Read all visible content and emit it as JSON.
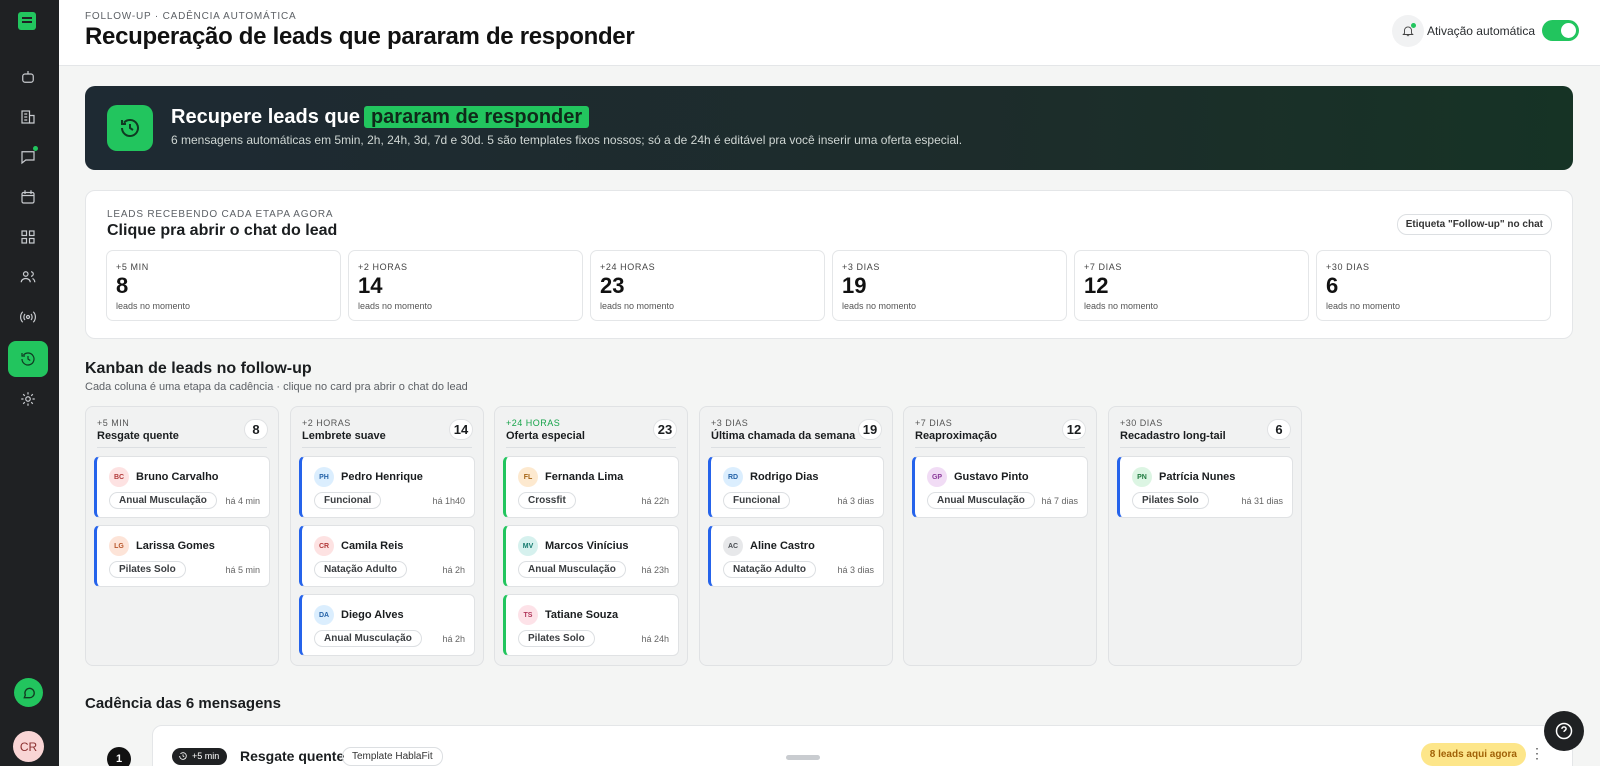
{
  "sidebar": {
    "user_initials": "CR",
    "items": [
      {
        "name": "bot-icon"
      },
      {
        "name": "building-icon"
      },
      {
        "name": "chat-icon"
      },
      {
        "name": "calendar-icon"
      },
      {
        "name": "grid-icon"
      },
      {
        "name": "users-icon"
      },
      {
        "name": "broadcast-icon"
      },
      {
        "name": "history-icon"
      },
      {
        "name": "gear-icon"
      }
    ]
  },
  "header": {
    "eyebrow": "FOLLOW-UP · CADÊNCIA AUTOMÁTICA",
    "title": "Recuperação de leads que pararam de responder",
    "toggle_label": "Ativação automática",
    "toggle_on": true
  },
  "banner": {
    "title_prefix": "Recupere leads que",
    "title_highlight": "pararam de responder",
    "subtitle": "6 mensagens automáticas em 5min, 2h, 24h, 3d, 7d e 30d. 5 são templates fixos nossos; só a de 24h é editável pra você inserir uma oferta especial."
  },
  "stats": {
    "eyebrow": "LEADS RECEBENDO CADA ETAPA AGORA",
    "title": "Clique pra abrir o chat do lead",
    "chip": "Etiqueta \"Follow-up\" no chat",
    "items": [
      {
        "label": "+5 MIN",
        "value": "8",
        "caption": "leads no momento"
      },
      {
        "label": "+2 HORAS",
        "value": "14",
        "caption": "leads no momento"
      },
      {
        "label": "+24 HORAS",
        "value": "23",
        "caption": "leads no momento"
      },
      {
        "label": "+3 DIAS",
        "value": "19",
        "caption": "leads no momento"
      },
      {
        "label": "+7 DIAS",
        "value": "12",
        "caption": "leads no momento"
      },
      {
        "label": "+30 DIAS",
        "value": "6",
        "caption": "leads no momento"
      }
    ]
  },
  "kanban": {
    "title": "Kanban de leads no follow-up",
    "subtitle": "Cada coluna é uma etapa da cadência · clique no card pra abrir o chat do lead",
    "columns": [
      {
        "tag": "+5 MIN",
        "name": "Resgate quente",
        "count": "8",
        "leads": [
          {
            "initials": "BC",
            "name": "Bruno Carvalho",
            "plan": "Anual Musculação",
            "time": "há 4 min"
          },
          {
            "initials": "LG",
            "name": "Larissa Gomes",
            "plan": "Pilates Solo",
            "time": "há 5 min"
          }
        ]
      },
      {
        "tag": "+2 HORAS",
        "name": "Lembrete suave",
        "count": "14",
        "leads": [
          {
            "initials": "PH",
            "name": "Pedro Henrique",
            "plan": "Funcional",
            "time": "há 1h40"
          },
          {
            "initials": "CR",
            "name": "Camila Reis",
            "plan": "Natação Adulto",
            "time": "há 2h"
          },
          {
            "initials": "DA",
            "name": "Diego Alves",
            "plan": "Anual Musculação",
            "time": "há 2h"
          }
        ]
      },
      {
        "tag": "+24 HORAS",
        "name": "Oferta especial",
        "count": "23",
        "leads": [
          {
            "initials": "FL",
            "name": "Fernanda Lima",
            "plan": "Crossfit",
            "time": "há 22h"
          },
          {
            "initials": "MV",
            "name": "Marcos Vinícius",
            "plan": "Anual Musculação",
            "time": "há 23h"
          },
          {
            "initials": "TS",
            "name": "Tatiane Souza",
            "plan": "Pilates Solo",
            "time": "há 24h"
          }
        ]
      },
      {
        "tag": "+3 DIAS",
        "name": "Última chamada da semana",
        "count": "19",
        "leads": [
          {
            "initials": "RD",
            "name": "Rodrigo Dias",
            "plan": "Funcional",
            "time": "há 3 dias"
          },
          {
            "initials": "AC",
            "name": "Aline Castro",
            "plan": "Natação Adulto",
            "time": "há 3 dias"
          }
        ]
      },
      {
        "tag": "+7 DIAS",
        "name": "Reaproximação",
        "count": "12",
        "leads": [
          {
            "initials": "GP",
            "name": "Gustavo Pinto",
            "plan": "Anual Musculação",
            "time": "há 7 dias"
          }
        ]
      },
      {
        "tag": "+30 DIAS",
        "name": "Recadastro long-tail",
        "count": "6",
        "leads": [
          {
            "initials": "PN",
            "name": "Patrícia Nunes",
            "plan": "Pilates Solo",
            "time": "há 31 dias"
          }
        ]
      }
    ]
  },
  "cadence": {
    "title": "Cadência das 6 mensagens",
    "step_number": "1",
    "chip": "+5 min",
    "step_name": "Resgate quente",
    "template": "Template HablaFit",
    "leads_badge": "8 leads aqui agora",
    "more": "⋮"
  },
  "colors": {
    "accent": "#22c55e",
    "sidebar": "#1f2123",
    "lead_border_blue": "#2563eb"
  }
}
